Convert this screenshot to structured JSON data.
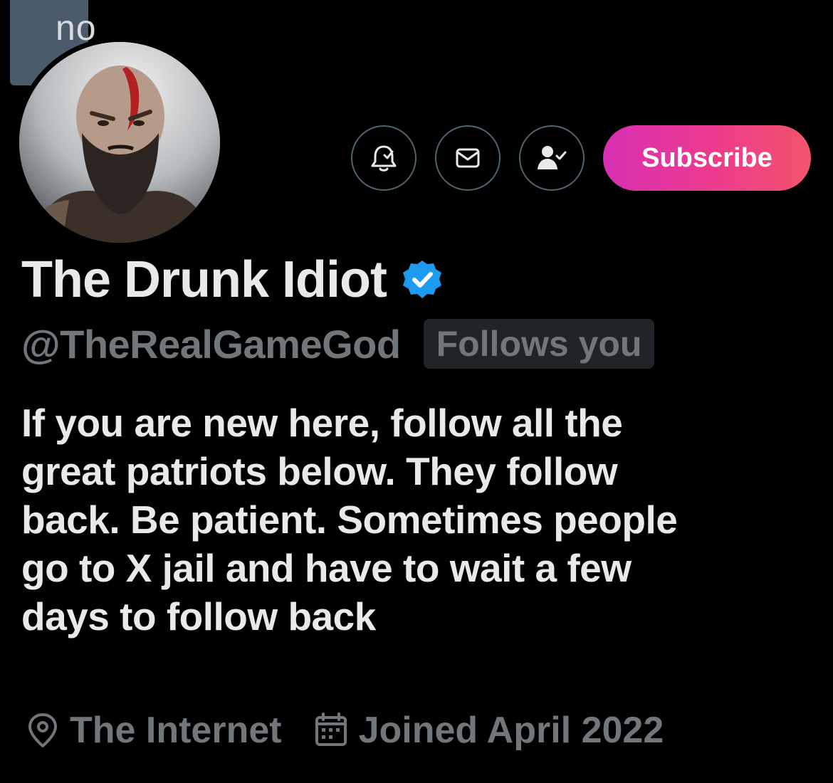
{
  "banner": {
    "partial_text": "no"
  },
  "actions": {
    "notify_icon": "bell-check-icon",
    "message_icon": "envelope-icon",
    "following_icon": "person-check-icon",
    "subscribe_label": "Subscribe",
    "subscribe_gradient": [
      "#d82fb3",
      "#f2556a"
    ]
  },
  "profile": {
    "display_name": "The Drunk Idiot",
    "verified_color": "#1d9bf0",
    "handle": "@TheRealGameGod",
    "follows_you": "Follows you",
    "bio_lines": [
      "If you are new here, follow all the",
      "great patriots below. They follow",
      "back. Be patient. Sometimes people",
      "go to X jail and have to wait a few",
      "days to follow back"
    ],
    "location": "The Internet",
    "joined": "Joined April 2022"
  }
}
